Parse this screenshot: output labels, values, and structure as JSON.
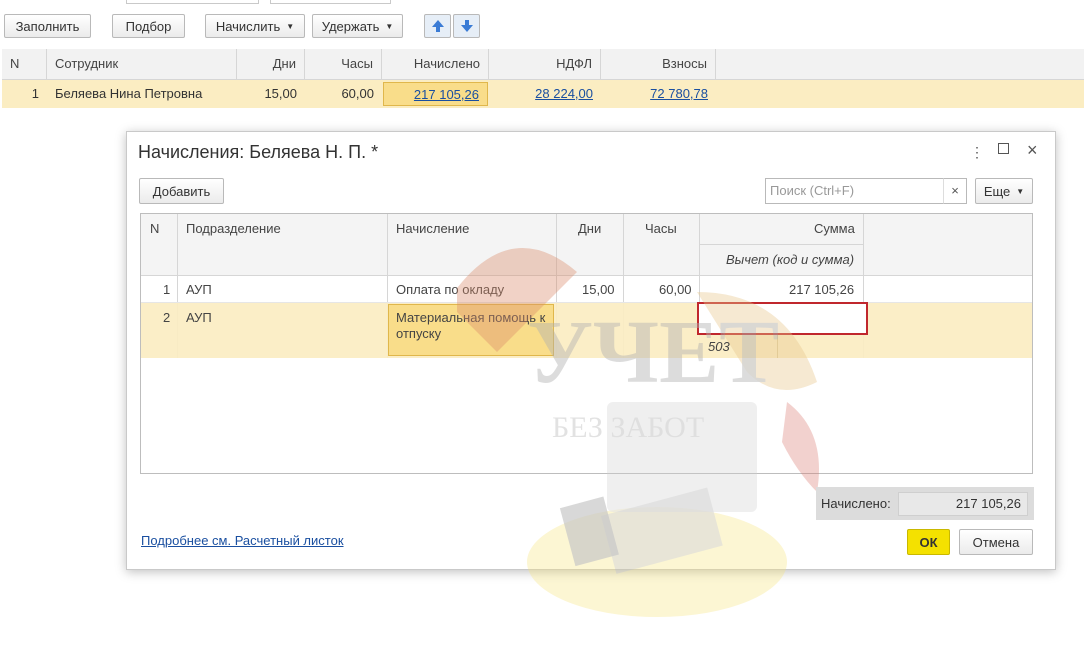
{
  "toolbar": {
    "fill": "Заполнить",
    "select": "Подбор",
    "accrue": "Начислить",
    "withhold": "Удержать",
    "up_icon": "arrow-up-icon",
    "down_icon": "arrow-down-icon"
  },
  "main_table": {
    "columns": [
      "N",
      "Сотрудник",
      "Дни",
      "Часы",
      "Начислено",
      "НДФЛ",
      "Взносы"
    ],
    "rows": [
      {
        "n": "1",
        "employee": "Беляева Нина Петровна",
        "days": "15,00",
        "hours": "60,00",
        "accrued": "217 105,26",
        "ndfl": "28 224,00",
        "contributions": "72 780,78"
      }
    ]
  },
  "dialog": {
    "title": "Начисления: Беляева Н. П. *",
    "add": "Добавить",
    "search_placeholder": "Поиск (Ctrl+F)",
    "search_clear": "×",
    "more": "Еще",
    "columns": {
      "n": "N",
      "department": "Подразделение",
      "accrual": "Начисление",
      "days": "Дни",
      "hours": "Часы",
      "sum": "Сумма",
      "deduction": "Вычет (код и сумма)"
    },
    "rows": [
      {
        "n": "1",
        "department": "АУП",
        "accrual": "Оплата по окладу",
        "days": "15,00",
        "hours": "60,00",
        "sum": "217 105,26",
        "deduction_code": ""
      },
      {
        "n": "2",
        "department": "АУП",
        "accrual": "Материальная помощь к отпуску",
        "days": "",
        "hours": "",
        "sum": "",
        "deduction_code": "503"
      }
    ],
    "total_label": "Начислено:",
    "total_value": "217 105,26",
    "details_link": "Подробнее см. Расчетный листок",
    "ok": "ОК",
    "cancel": "Отмена"
  },
  "watermark": {
    "line1": "УЧЕТ",
    "line2": "БЕЗ ЗАБОТ"
  },
  "colors": {
    "selected_row": "#fbedc2",
    "link": "#1a4fa0",
    "ok_button": "#f4e100",
    "error_border": "#c0272d"
  }
}
